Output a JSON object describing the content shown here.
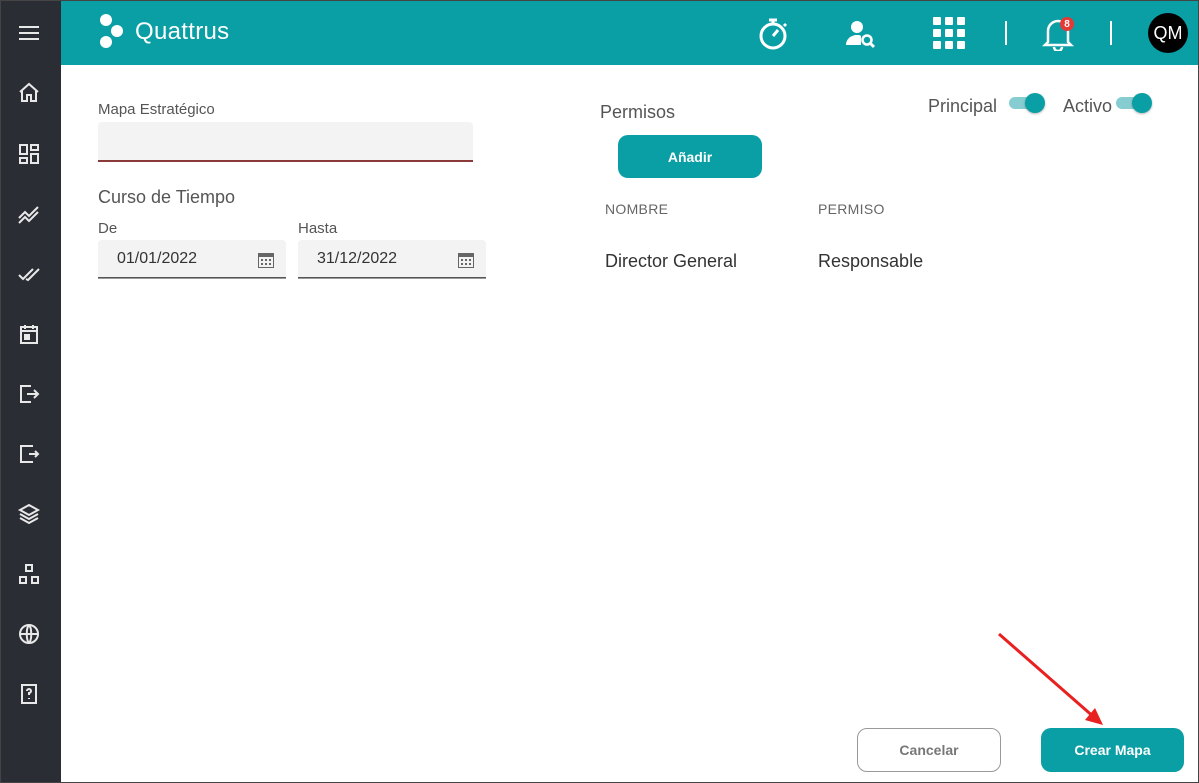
{
  "app": {
    "name": "Quattrus"
  },
  "topbar": {
    "icons": [
      "stopwatch-icon",
      "user-search-icon",
      "apps-grid-icon",
      "bell-icon"
    ],
    "notifications_count": "8",
    "avatar_initials": "QM"
  },
  "sidebar": {
    "items": [
      "menu-icon",
      "home-icon",
      "dashboard-icon",
      "trending-icon",
      "done-all-icon",
      "calendar-icon",
      "login-icon",
      "logout-icon",
      "layers-icon",
      "hierarchy-icon",
      "globe-icon",
      "help-book-icon"
    ]
  },
  "form": {
    "mapa_label": "Mapa Estratégico",
    "mapa_value": "",
    "curso_label": "Curso de Tiempo",
    "de_label": "De",
    "de_value": "01/01/2022",
    "hasta_label": "Hasta",
    "hasta_value": "31/12/2022"
  },
  "permisos": {
    "title": "Permisos",
    "add_label": "Añadir",
    "columns": [
      "NOMBRE",
      "PERMISO"
    ],
    "rows": [
      {
        "nombre": "Director General",
        "permiso": "Responsable"
      }
    ]
  },
  "toggles": {
    "principal_label": "Principal",
    "principal_on": true,
    "activo_label": "Activo",
    "activo_on": true
  },
  "actions": {
    "cancel_label": "Cancelar",
    "create_label": "Crear Mapa"
  },
  "colors": {
    "accent": "#0a9ea5",
    "sidebar": "#2a2d33",
    "annotation_arrow": "#e8201f"
  }
}
